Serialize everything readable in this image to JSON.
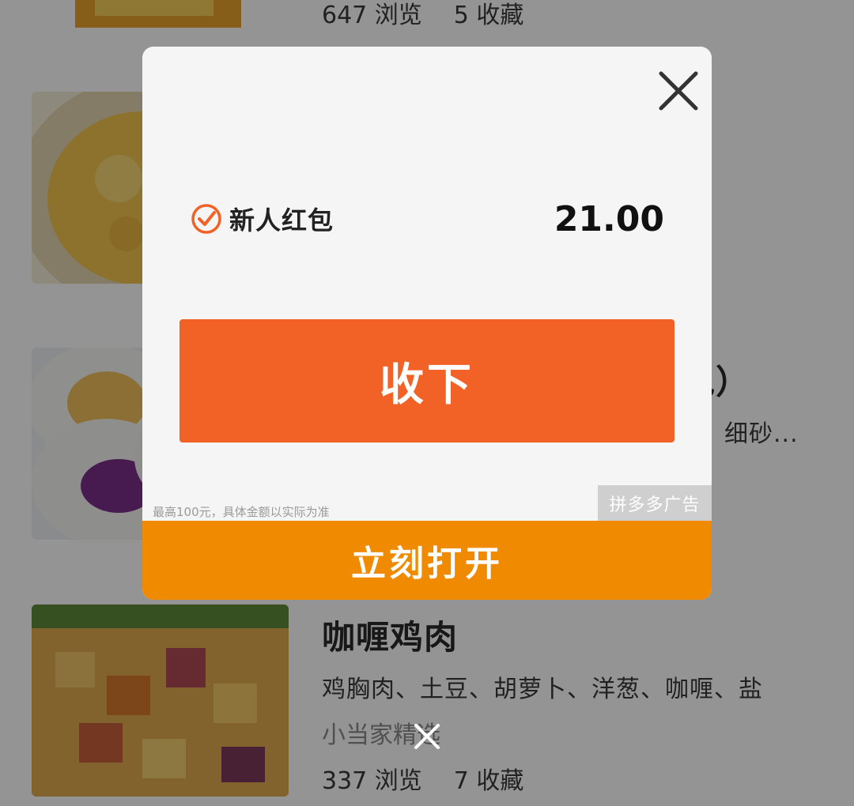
{
  "list": {
    "item0": {
      "views": "647 浏览",
      "favorites": "5 收藏"
    },
    "item2": {
      "title_tail": "包）",
      "ingredients_tail": "细砂..."
    },
    "item3": {
      "title": "咖喱鸡肉",
      "ingredients": "鸡胸肉、土豆、胡萝卜、洋葱、咖喱、盐",
      "source": "小当家精选",
      "views": "337 浏览",
      "favorites": "7 收藏"
    }
  },
  "modal": {
    "coupon_label": "新人红包",
    "coupon_amount": "21.00",
    "accept_label": "收下",
    "disclaimer": "最高100元，具体金额以实际为准",
    "ad_badge": "拼多多广告",
    "open_label": "立刻打开"
  },
  "colors": {
    "accept": "#f26125",
    "open": "#f08a00",
    "check": "#f26125"
  },
  "icons": {
    "close": "close-icon",
    "check": "check-circle-icon",
    "dismiss": "close-icon"
  }
}
